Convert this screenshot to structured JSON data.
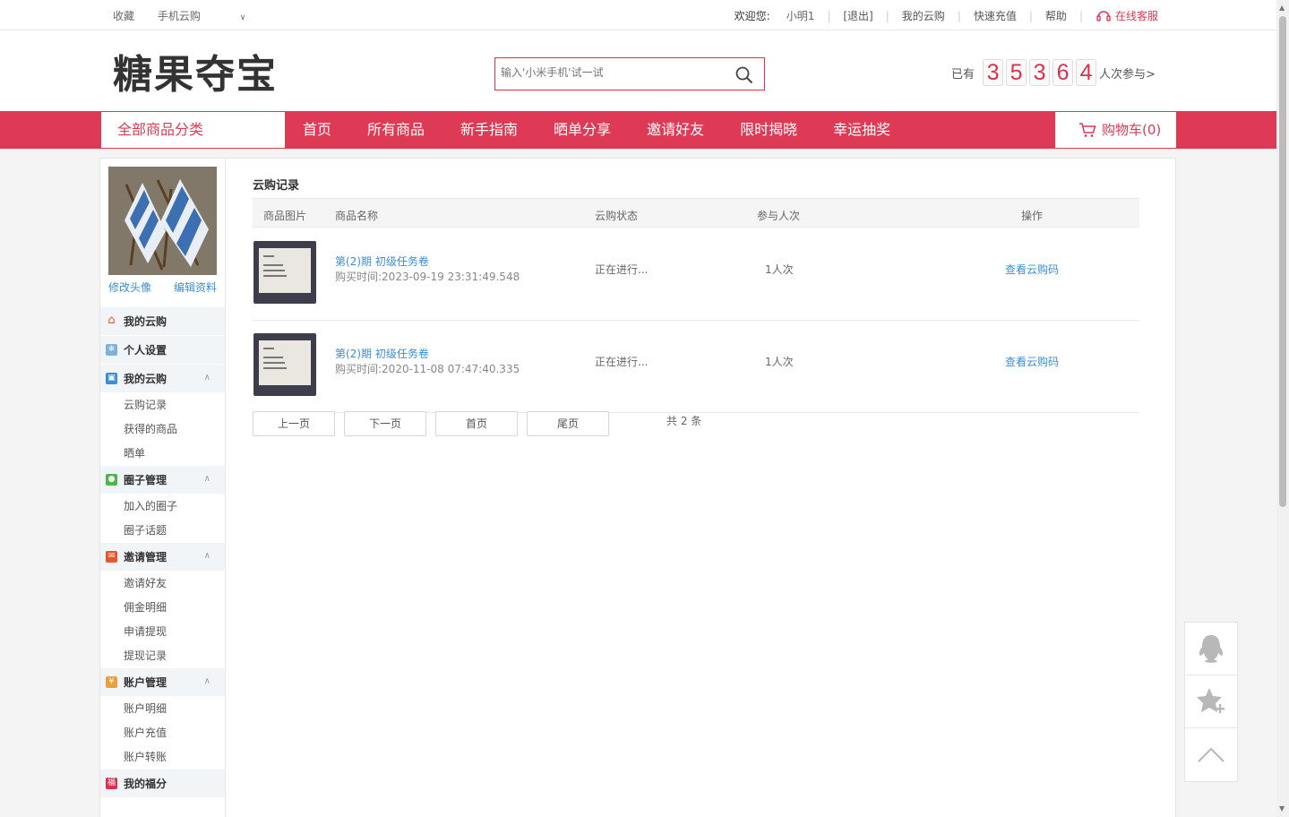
{
  "topbar": {
    "favorite": "收藏",
    "mobile": "手机云购",
    "welcome": "欢迎您:",
    "username": "小明1",
    "logout": "[退出]",
    "my_yungou": "我的云购",
    "recharge": "快速充值",
    "help": "帮助",
    "service": "在线客服"
  },
  "header": {
    "logo": "糖果夺宝",
    "search_placeholder": "输入'小米手机'试一试",
    "counter_pre": "已有",
    "counter_digits": [
      "3",
      "5",
      "3",
      "6",
      "4"
    ],
    "counter_post": "人次参与>"
  },
  "nav": {
    "categories": "全部商品分类",
    "items": [
      "首页",
      "所有商品",
      "新手指南",
      "晒单分享",
      "邀请好友",
      "限时揭晓",
      "幸运抽奖"
    ],
    "cart": "购物车(0)"
  },
  "sidebar": {
    "edit_avatar": "修改头像",
    "edit_profile": "编辑资料",
    "sections": [
      {
        "title": "我的云购",
        "icon": "home-icon",
        "color": "#e8562a",
        "items": []
      },
      {
        "title": "个人设置",
        "icon": "settings-icon",
        "color": "#7fb2d8",
        "items": []
      },
      {
        "title": "我的云购",
        "icon": "cart-icon",
        "color": "#3a8ed8",
        "items": [
          "云购记录",
          "获得的商品",
          "晒单"
        ]
      },
      {
        "title": "圈子管理",
        "icon": "circle-icon",
        "color": "#48b84a",
        "items": [
          "加入的圈子",
          "圈子话题"
        ]
      },
      {
        "title": "邀请管理",
        "icon": "invite-icon",
        "color": "#e8562a",
        "items": [
          "邀请好友",
          "佣金明细",
          "申请提现",
          "提现记录"
        ]
      },
      {
        "title": "账户管理",
        "icon": "yen-icon",
        "color": "#e9a23b",
        "items": [
          "账户明细",
          "账户充值",
          "账户转账"
        ]
      },
      {
        "title": "我的福分",
        "icon": "fu-icon",
        "color": "#d9324f",
        "items": []
      }
    ]
  },
  "content": {
    "title": "云购记录",
    "headers": [
      "商品图片",
      "商品名称",
      "云购状态",
      "参与人次",
      "操作"
    ],
    "rows": [
      {
        "name": "第(2)期 初级任务卷",
        "time": "购买时间:2023-09-19 23:31:49.548",
        "status": "正在进行...",
        "count": "1人次",
        "action": "查看云购码"
      },
      {
        "name": "第(2)期 初级任务卷",
        "time": "购买时间:2020-11-08 07:47:40.335",
        "status": "正在进行...",
        "count": "1人次",
        "action": "查看云购码"
      }
    ],
    "pager": {
      "prev": "上一页",
      "next": "下一页",
      "first": "首页",
      "last": "尾页",
      "total": "共 2 条"
    }
  }
}
